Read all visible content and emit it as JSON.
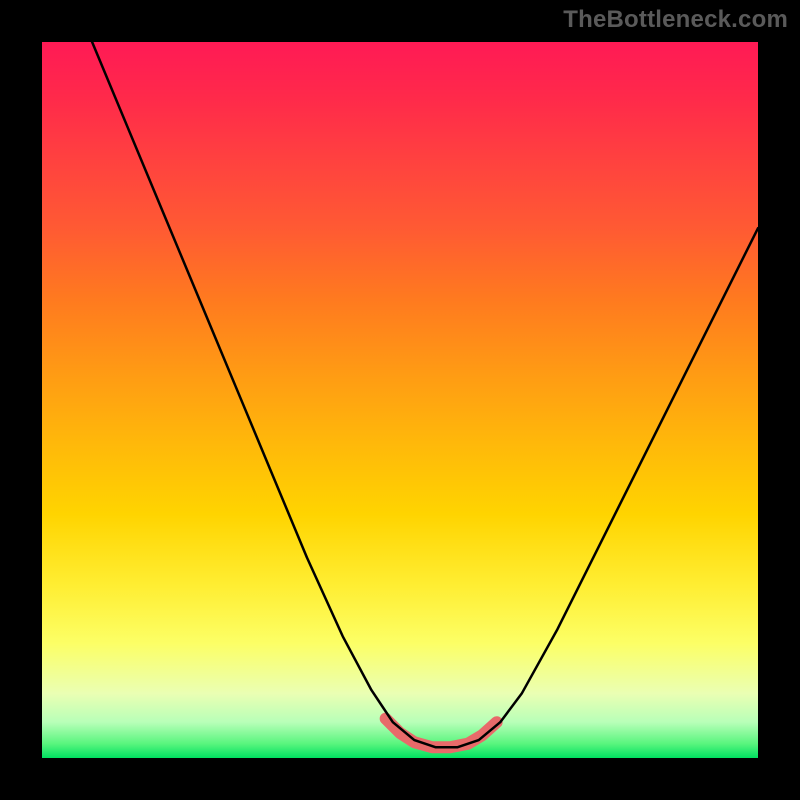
{
  "watermark": "TheBottleneck.com",
  "chart_data": {
    "type": "line",
    "title": "",
    "xlabel": "",
    "ylabel": "",
    "xlim": [
      0,
      1
    ],
    "ylim": [
      0,
      1
    ],
    "series": [
      {
        "name": "curve-black",
        "color": "#000000",
        "width": 2.5,
        "points": [
          {
            "x": 0.07,
            "y": 1.0
          },
          {
            "x": 0.12,
            "y": 0.88
          },
          {
            "x": 0.17,
            "y": 0.76
          },
          {
            "x": 0.22,
            "y": 0.64
          },
          {
            "x": 0.27,
            "y": 0.52
          },
          {
            "x": 0.32,
            "y": 0.4
          },
          {
            "x": 0.37,
            "y": 0.28
          },
          {
            "x": 0.42,
            "y": 0.17
          },
          {
            "x": 0.46,
            "y": 0.095
          },
          {
            "x": 0.49,
            "y": 0.05
          },
          {
            "x": 0.52,
            "y": 0.025
          },
          {
            "x": 0.55,
            "y": 0.015
          },
          {
            "x": 0.58,
            "y": 0.015
          },
          {
            "x": 0.61,
            "y": 0.025
          },
          {
            "x": 0.64,
            "y": 0.05
          },
          {
            "x": 0.67,
            "y": 0.09
          },
          {
            "x": 0.72,
            "y": 0.18
          },
          {
            "x": 0.78,
            "y": 0.3
          },
          {
            "x": 0.84,
            "y": 0.42
          },
          {
            "x": 0.9,
            "y": 0.54
          },
          {
            "x": 0.96,
            "y": 0.66
          },
          {
            "x": 1.0,
            "y": 0.74
          }
        ]
      },
      {
        "name": "bottom-highlight",
        "color": "#e86a6a",
        "width": 12,
        "points": [
          {
            "x": 0.48,
            "y": 0.055
          },
          {
            "x": 0.5,
            "y": 0.035
          },
          {
            "x": 0.52,
            "y": 0.022
          },
          {
            "x": 0.545,
            "y": 0.015
          },
          {
            "x": 0.57,
            "y": 0.015
          },
          {
            "x": 0.595,
            "y": 0.02
          },
          {
            "x": 0.615,
            "y": 0.032
          },
          {
            "x": 0.635,
            "y": 0.05
          }
        ]
      }
    ]
  }
}
